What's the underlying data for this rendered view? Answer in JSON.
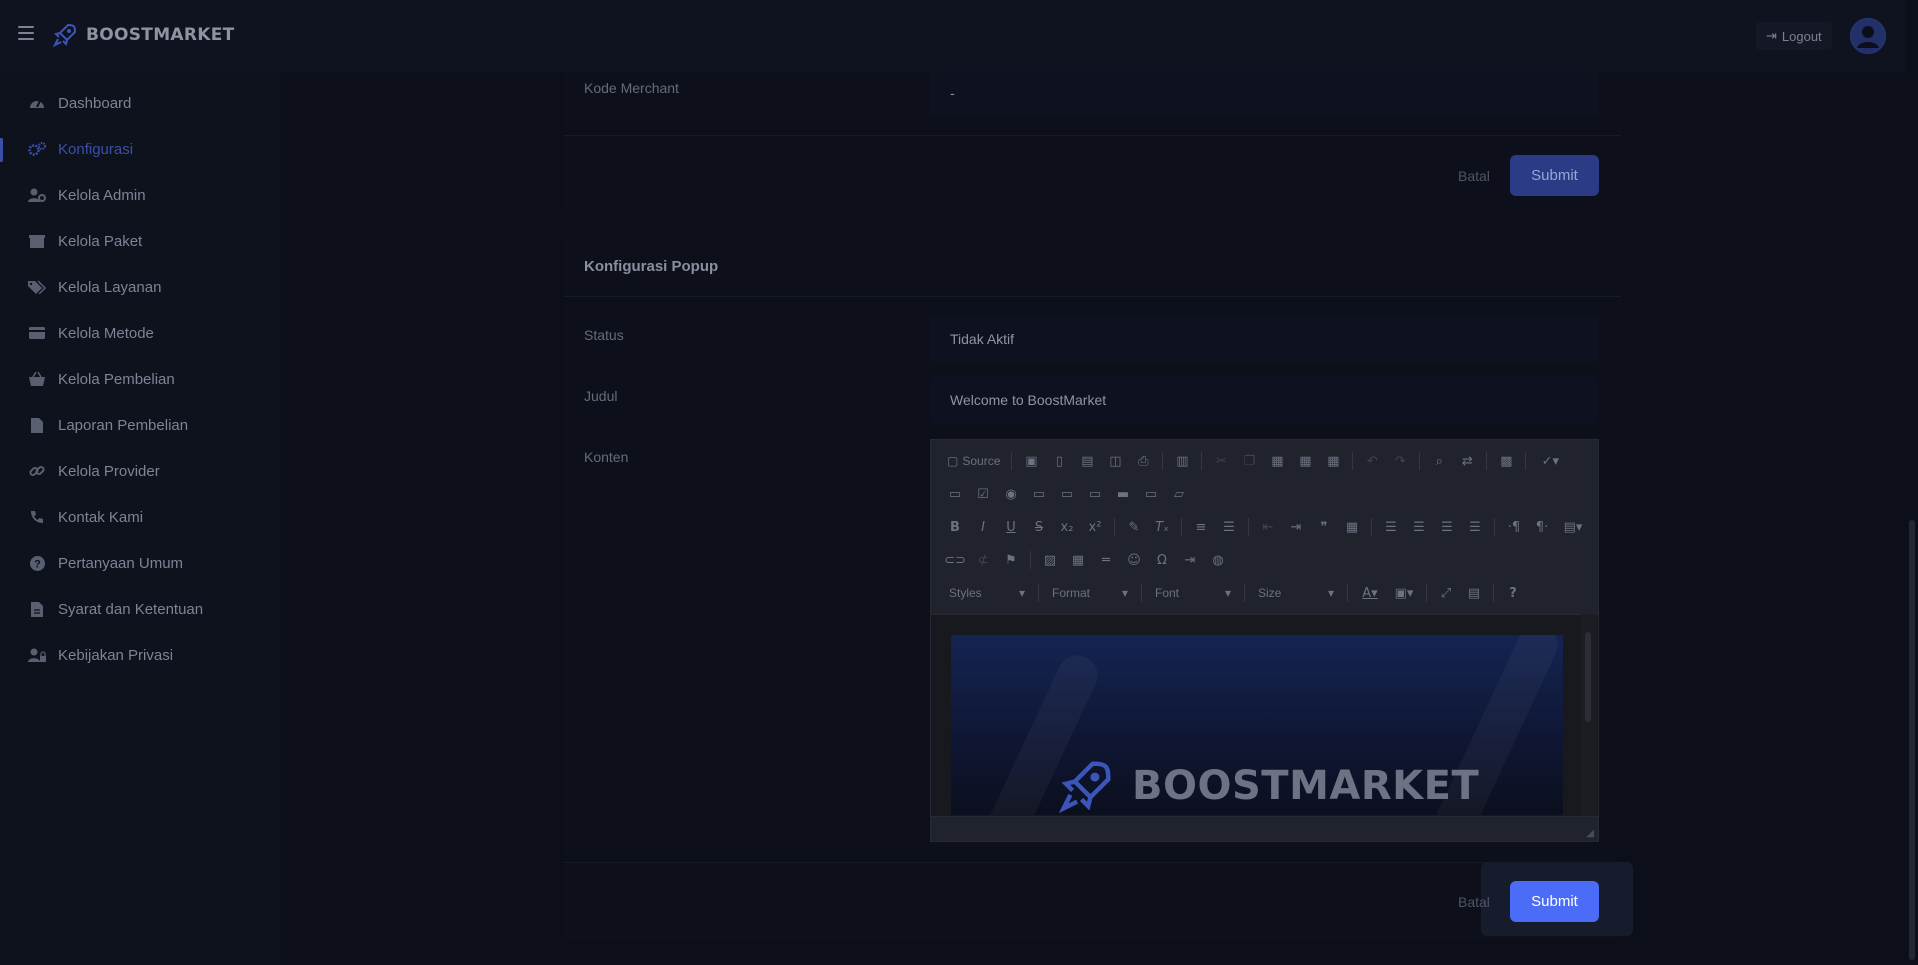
{
  "brand": {
    "name": "BOOSTMARKET"
  },
  "header": {
    "logout_label": "Logout"
  },
  "sidebar": {
    "items": [
      {
        "label": "Dashboard",
        "icon": "dashboard-icon"
      },
      {
        "label": "Konfigurasi",
        "icon": "gears-icon",
        "active": true
      },
      {
        "label": "Kelola Admin",
        "icon": "user-gear-icon"
      },
      {
        "label": "Kelola Paket",
        "icon": "box-icon"
      },
      {
        "label": "Kelola Layanan",
        "icon": "tags-icon"
      },
      {
        "label": "Kelola Metode",
        "icon": "credit-card-icon"
      },
      {
        "label": "Kelola Pembelian",
        "icon": "basket-icon"
      },
      {
        "label": "Laporan Pembelian",
        "icon": "file-icon"
      },
      {
        "label": "Kelola Provider",
        "icon": "link-icon"
      },
      {
        "label": "Kontak Kami",
        "icon": "phone-icon"
      },
      {
        "label": "Pertanyaan Umum",
        "icon": "question-icon"
      },
      {
        "label": "Syarat dan Ketentuan",
        "icon": "file-text-icon"
      },
      {
        "label": "Kebijakan Privasi",
        "icon": "user-lock-icon"
      }
    ]
  },
  "merchant_section": {
    "kode_label": "Kode Merchant",
    "kode_value": "-",
    "batal_label": "Batal",
    "submit_label": "Submit"
  },
  "popup_section": {
    "title": "Konfigurasi Popup",
    "status_label": "Status",
    "status_value": "Tidak Aktif",
    "judul_label": "Judul",
    "judul_value": "Welcome to BoostMarket",
    "konten_label": "Konten",
    "batal_label": "Batal",
    "submit_label": "Submit"
  },
  "editor": {
    "source_label": "Source",
    "styles_label": "Styles",
    "format_label": "Format",
    "font_label": "Font",
    "size_label": "Size",
    "banner_text": "BOOSTMARKET"
  },
  "colors": {
    "accent": "#4a6cf7",
    "active_nav": "#3b4fa8",
    "background": "#0c0f19"
  }
}
